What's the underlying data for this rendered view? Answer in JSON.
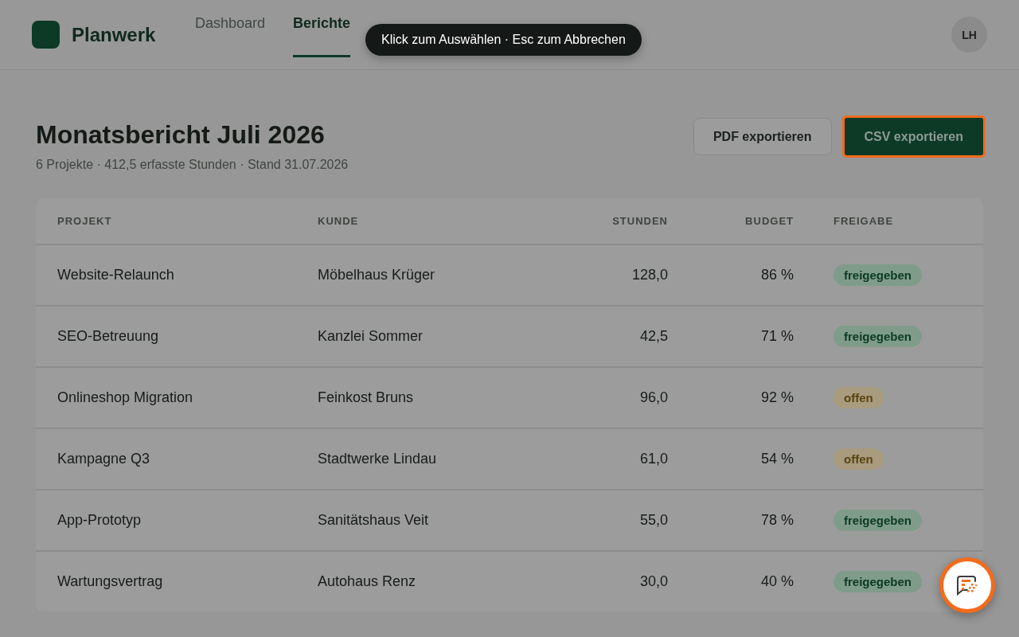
{
  "app": {
    "name": "Planwerk",
    "avatar": "LH"
  },
  "nav": [
    {
      "label": "Dashboard",
      "selected": false
    },
    {
      "label": "Berichte",
      "selected": true
    }
  ],
  "tooltip": "Klick zum Auswählen · Esc zum Abbrechen",
  "report": {
    "title": "Monatsbericht Juli 2026",
    "subtitle": "6 Projekte · 412,5 erfasste Stunden · Stand 31.07.2026"
  },
  "buttons": [
    {
      "label": "PDF exportieren",
      "kind": "secondary",
      "highlighted": false
    },
    {
      "label": "CSV exportieren",
      "kind": "primary",
      "highlighted": true
    }
  ],
  "table": {
    "columns": [
      "PROJEKT",
      "KUNDE",
      "STUNDEN",
      "BUDGET",
      "FREIGABE"
    ],
    "rows": [
      {
        "project": "Website-Relaunch",
        "client": "Möbelhaus Krüger",
        "hours": "128,0",
        "budget": "86 %",
        "status": {
          "label": "freigegeben",
          "kind": "approved"
        }
      },
      {
        "project": "SEO-Betreuung",
        "client": "Kanzlei Sommer",
        "hours": "42,5",
        "budget": "71 %",
        "status": {
          "label": "freigegeben",
          "kind": "approved"
        }
      },
      {
        "project": "Onlineshop Migration",
        "client": "Feinkost Bruns",
        "hours": "96,0",
        "budget": "92 %",
        "status": {
          "label": "offen",
          "kind": "open"
        }
      },
      {
        "project": "Kampagne Q3",
        "client": "Stadtwerke Lindau",
        "hours": "61,0",
        "budget": "54 %",
        "status": {
          "label": "offen",
          "kind": "open"
        }
      },
      {
        "project": "App-Prototyp",
        "client": "Sanitätshaus Veit",
        "hours": "55,0",
        "budget": "78 %",
        "status": {
          "label": "freigegeben",
          "kind": "approved"
        }
      },
      {
        "project": "Wartungsvertrag",
        "client": "Autohaus Renz",
        "hours": "30,0",
        "budget": "40 %",
        "status": {
          "label": "freigegeben",
          "kind": "approved"
        }
      }
    ]
  }
}
